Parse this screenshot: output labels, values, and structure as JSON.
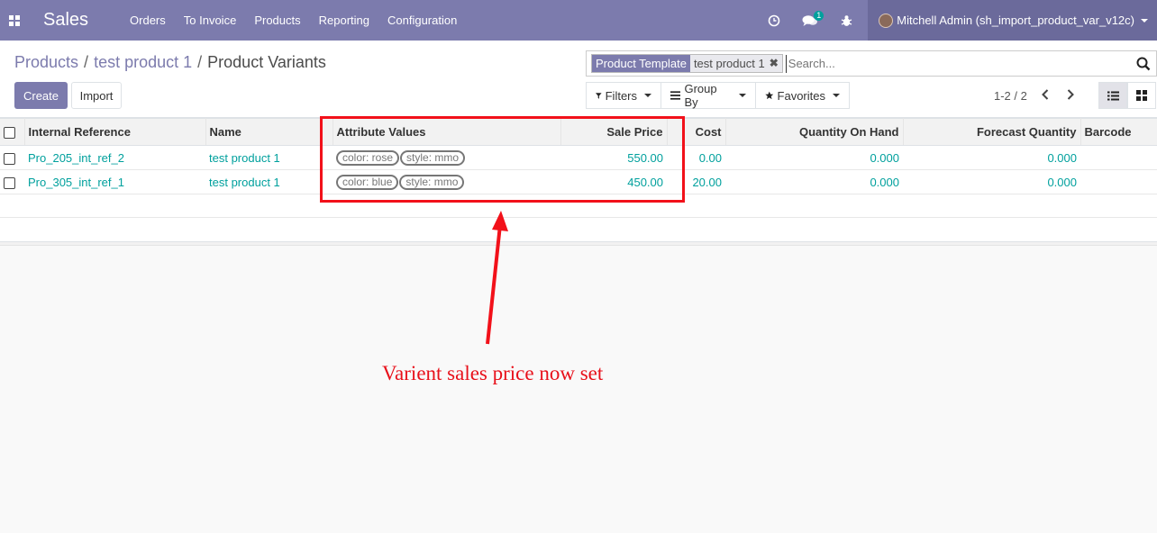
{
  "navbar": {
    "app_name": "Sales",
    "menu": [
      "Orders",
      "To Invoice",
      "Products",
      "Reporting",
      "Configuration"
    ],
    "messages_badge": "1",
    "user": "Mitchell Admin (sh_import_product_var_v12c)",
    "icons": [
      "apps-icon",
      "clock-icon",
      "chat-icon",
      "bug-icon"
    ]
  },
  "breadcrumb": {
    "items": [
      "Products",
      "test product 1"
    ],
    "current": "Product Variants",
    "separator": "/"
  },
  "buttons": {
    "create": "Create",
    "import": "Import"
  },
  "search": {
    "facet_label": "Product Template",
    "facet_value": "test product 1",
    "placeholder": "Search..."
  },
  "filters": {
    "filters": "Filters",
    "group_by": "Group By",
    "favorites": "Favorites"
  },
  "pager": {
    "value": "1-2 / 2"
  },
  "table": {
    "columns": [
      "Internal Reference",
      "Name",
      "Attribute Values",
      "Sale Price",
      "Cost",
      "Quantity On Hand",
      "Forecast Quantity",
      "Barcode"
    ],
    "rows": [
      {
        "ref": "Pro_205_int_ref_2",
        "name": "test product 1",
        "attrs": [
          "color: rose",
          "style: mmo"
        ],
        "sale_price": "550.00",
        "cost": "0.00",
        "qty": "0.000",
        "forecast": "0.000",
        "barcode": ""
      },
      {
        "ref": "Pro_305_int_ref_1",
        "name": "test product 1",
        "attrs": [
          "color: blue",
          "style: mmo"
        ],
        "sale_price": "450.00",
        "cost": "20.00",
        "qty": "0.000",
        "forecast": "0.000",
        "barcode": ""
      }
    ]
  },
  "annotation": {
    "text": "Varient sales price now set",
    "color": "#e8101a"
  },
  "colors": {
    "brand": "#7c7bad",
    "link": "#00a09d"
  }
}
